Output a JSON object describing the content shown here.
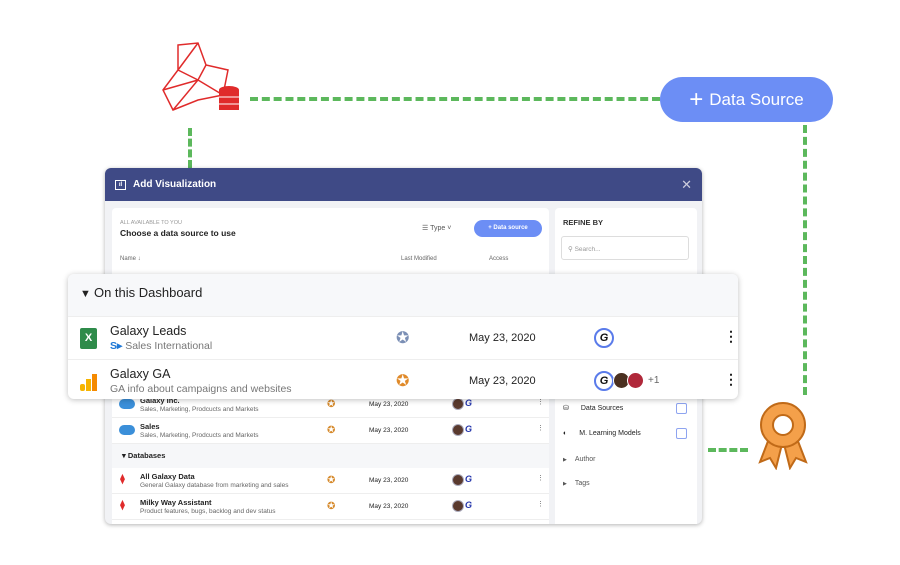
{
  "top_button": {
    "label": "Data Source",
    "icon": "plus-icon"
  },
  "colors": {
    "accent": "#6c8ef5",
    "header": "#3f4a86",
    "connector": "#5cb85c",
    "award": "#e08a2a",
    "sql": "#e02b2b"
  },
  "dialog": {
    "title": "Add Visualization",
    "subtitle": "ALL AVAILABLE TO YOU",
    "heading": "Choose a data source to use",
    "type_label": "Type",
    "data_source_button": "Data source",
    "columns": {
      "name": "Name",
      "last_modified": "Last Modified",
      "access": "Access"
    },
    "rows": [
      {
        "title": "Galaxy Inc.",
        "subtitle": "Sales, Marketing, Prodcucts and Markets",
        "date": "May 23, 2020",
        "icon": "salesforce-icon"
      },
      {
        "title": "Sales",
        "subtitle": "Sales, Marketing, Prodcucts and Markets",
        "date": "May 23, 2020",
        "icon": "salesforce-icon"
      }
    ],
    "databases_label": "Databases",
    "db_rows": [
      {
        "title": "All Galaxy Data",
        "subtitle": "General Galaxy database from marketing and sales",
        "date": "May 23, 2020",
        "icon": "sql-server-icon"
      },
      {
        "title": "Milky Way Assistant",
        "subtitle": "Product features, bugs, backlog and dev status",
        "date": "May 23, 2020",
        "icon": "sql-server-icon"
      }
    ],
    "refine": {
      "title": "REFINE BY",
      "search_placeholder": "Search...",
      "filters": [
        {
          "label": "Data Sources"
        },
        {
          "label": "M. Learning Models"
        }
      ],
      "sections": [
        {
          "label": "Author"
        },
        {
          "label": "Tags"
        }
      ]
    }
  },
  "card": {
    "section": "On this Dashboard",
    "rows": [
      {
        "title": "Galaxy Leads",
        "subtitle": "Sales International",
        "date": "May 23, 2020",
        "icon": "excel-icon",
        "extra": ""
      },
      {
        "title": "Galaxy GA",
        "subtitle": "GA info about campaigns and websites",
        "date": "May 23, 2020",
        "icon": "google-analytics-icon",
        "extra": "+1"
      }
    ]
  }
}
